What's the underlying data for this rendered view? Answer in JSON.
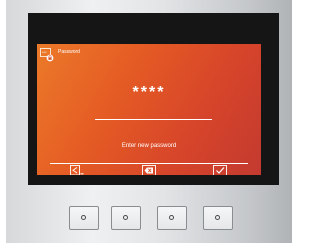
{
  "screen": {
    "title_icon": "password-icon",
    "title": "Password",
    "password_value": "****",
    "prompt": "Enter new password"
  },
  "softkeys": [
    {
      "icon": "back-icon"
    },
    {
      "icon": "delete-icon"
    },
    {
      "icon": "confirm-icon"
    }
  ],
  "hardware_keys": [
    {
      "icon": "key-dot-icon"
    },
    {
      "icon": "key-dot-icon"
    },
    {
      "icon": "key-dot-icon"
    },
    {
      "icon": "key-dot-icon"
    }
  ],
  "colors": {
    "screen_gradient_start": "#eb7a29",
    "screen_gradient_end": "#c33a30",
    "bezel": "#151515",
    "text": "#ffffff"
  }
}
